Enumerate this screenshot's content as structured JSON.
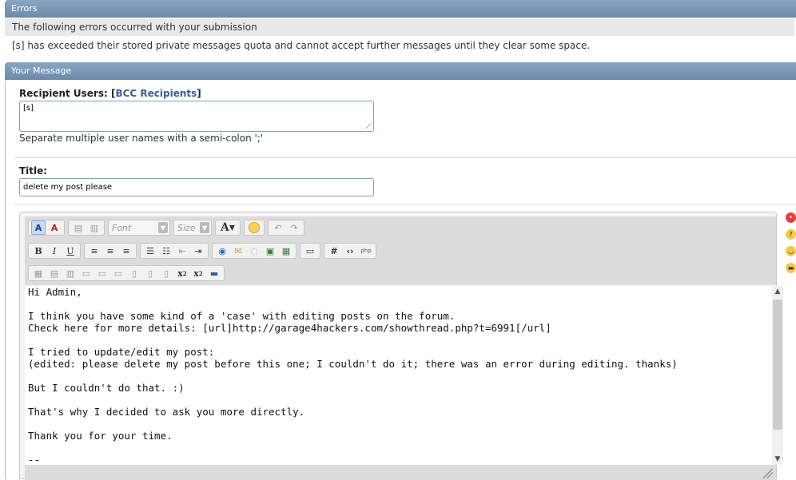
{
  "errors": {
    "title": "Errors",
    "heading": "The following errors occurred with your submission",
    "message": "[s] has exceeded their stored private messages quota and cannot accept further messages until they clear some space."
  },
  "message_section": {
    "title": "Your Message",
    "recipient_label": "Recipient Users:",
    "bcc_open": "[",
    "bcc_link": "BCC Recipients",
    "bcc_close": "]",
    "recipient_value": "[s]",
    "recipient_hint": "Separate multiple user names with a semi-colon ';'",
    "title_label": "Title:",
    "title_value": "delete my post please"
  },
  "editor": {
    "font_placeholder": "Font",
    "size_placeholder": "Size",
    "lines": [
      "Hi Admin,",
      "",
      "I think you have some kind of a 'case' with editing posts on the forum.",
      "Check here for more details: [url]http://garage4hackers.com/showthread.php?t=6991[/url]",
      "",
      "I tried to update/edit my post:",
      "(edited: please delete my post before this one; I couldn't do it; there was an error during editing. thanks)",
      "",
      "But I couldn't do that. :)",
      "",
      "That's why I decided to ask you more directly.",
      "",
      "Thank you for your time.",
      "",
      "--"
    ]
  },
  "colors": {
    "header_bar": "#7a98b6",
    "link": "#3e5c92",
    "field_border": "#7d9fbc"
  }
}
